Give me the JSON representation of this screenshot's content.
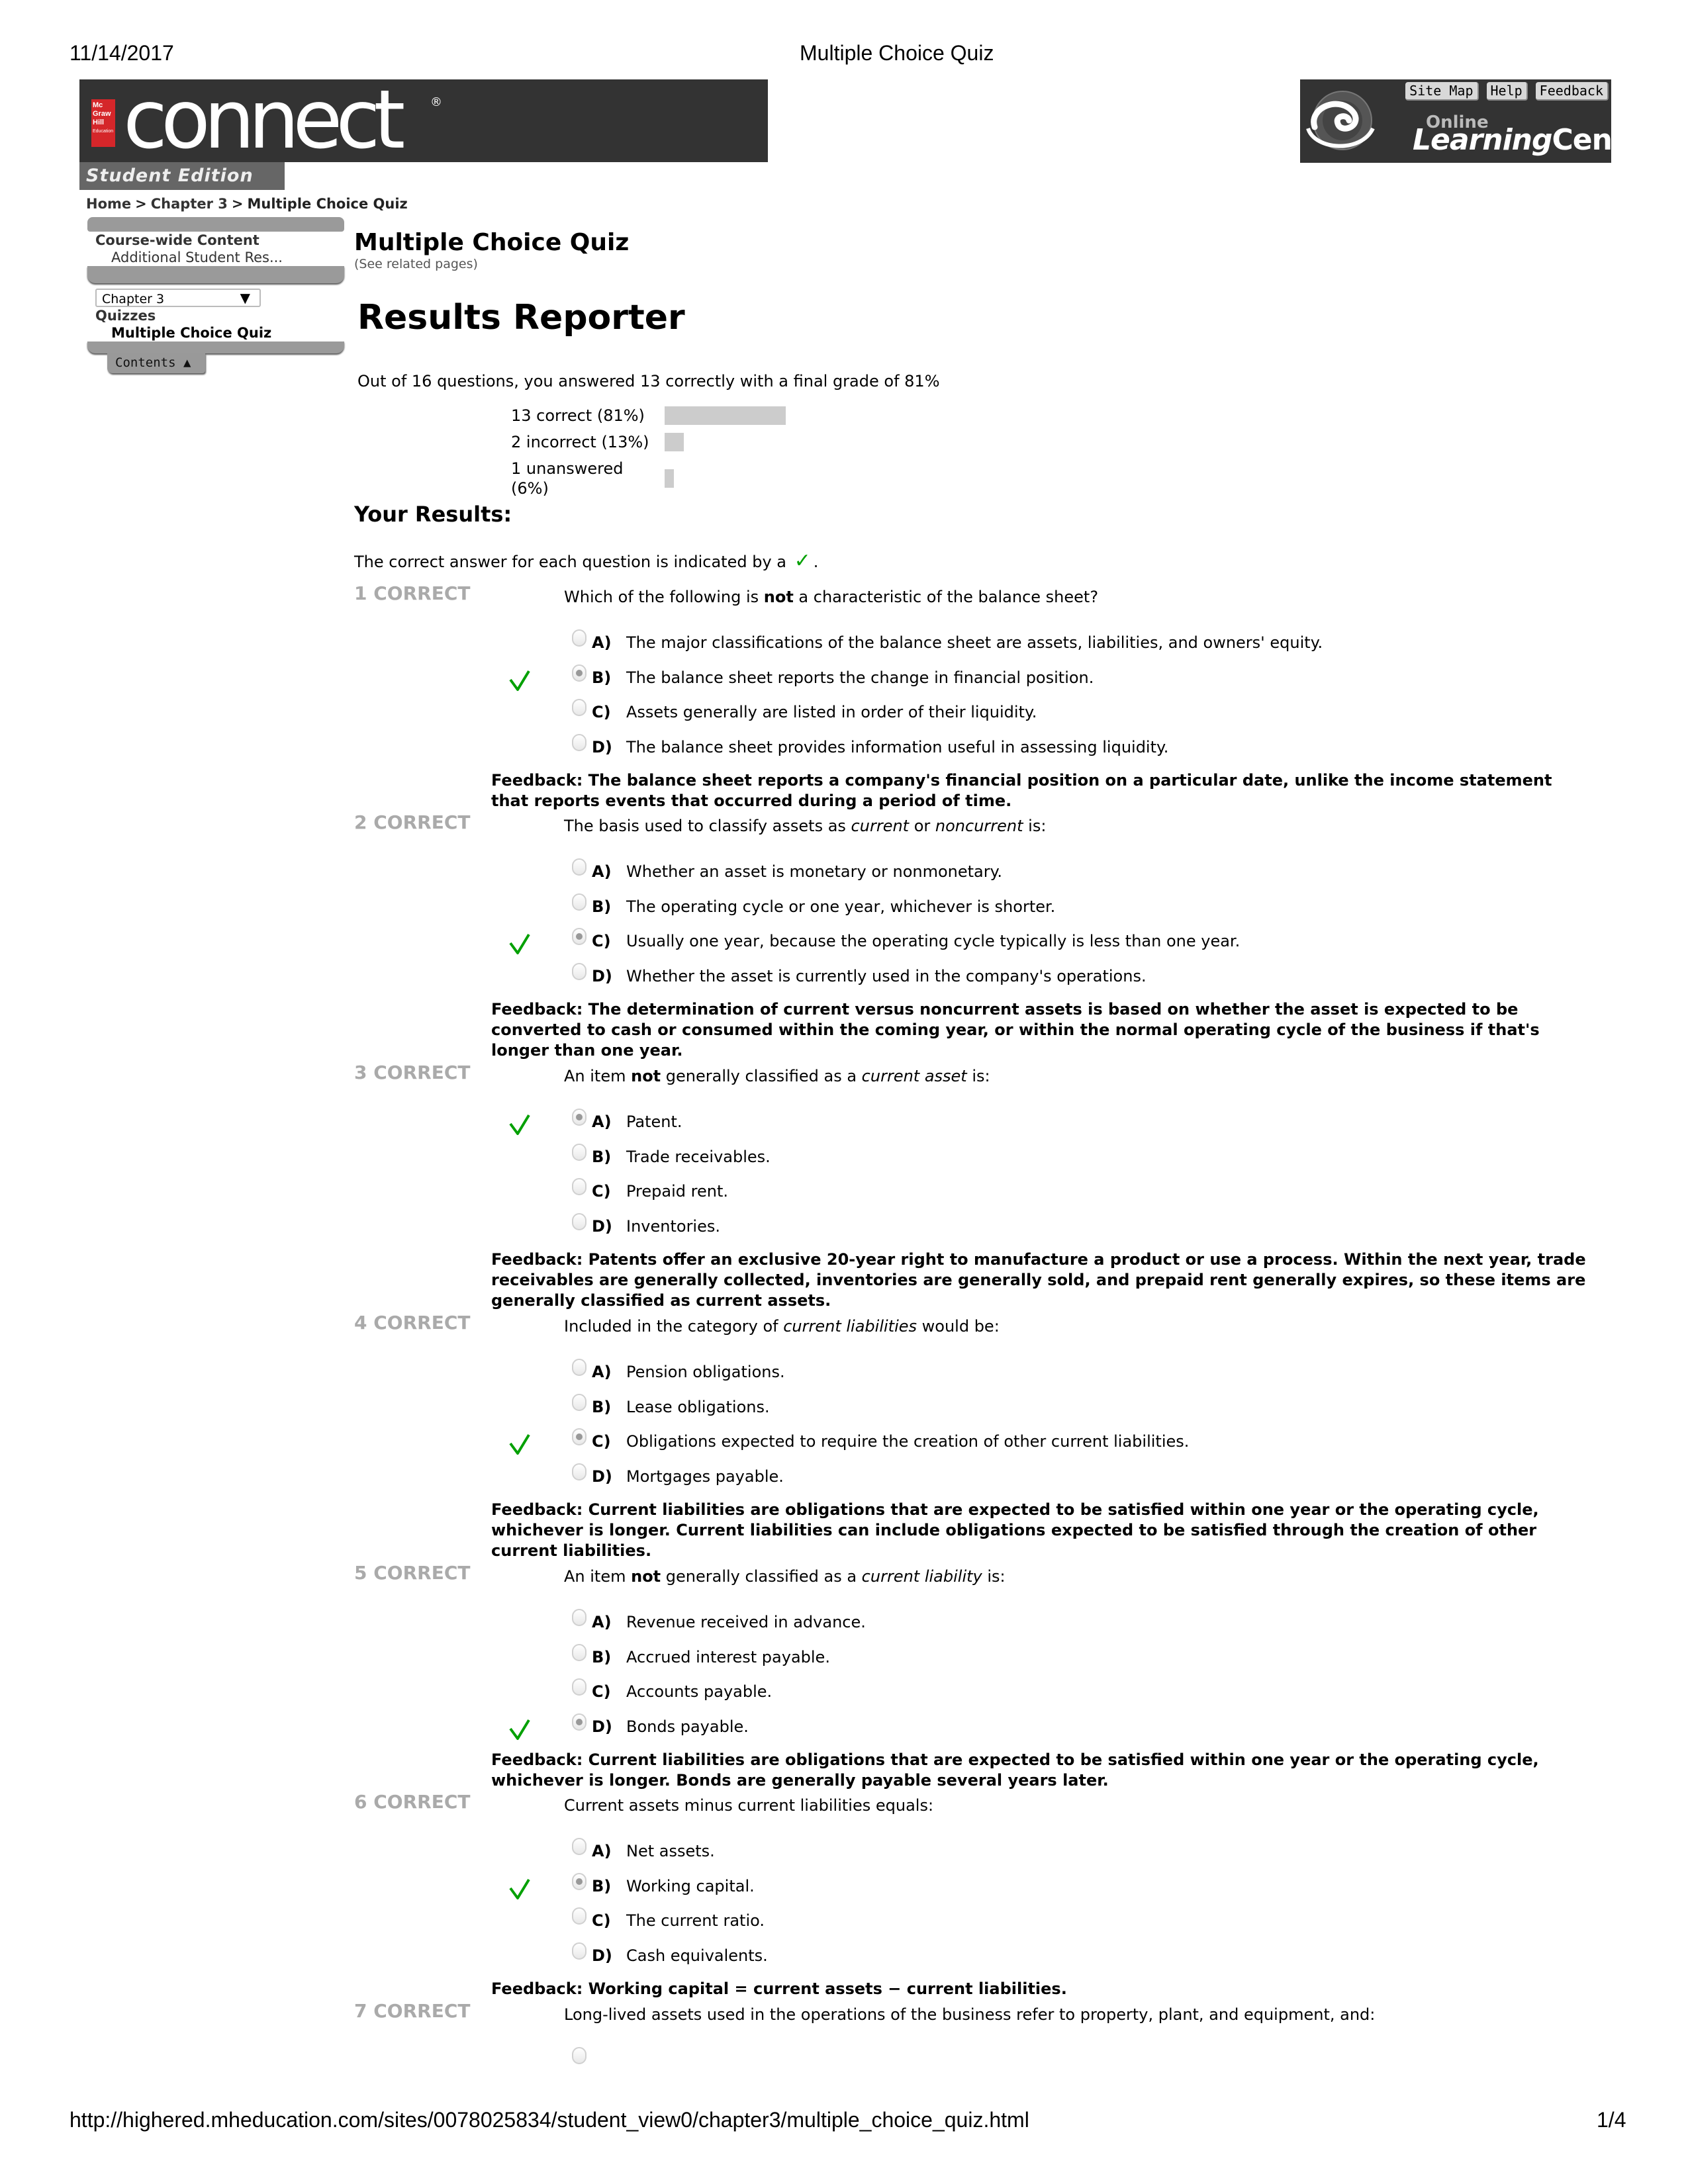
{
  "print_header": {
    "date": "11/14/2017",
    "title": "Multiple Choice Quiz"
  },
  "print_footer": {
    "url": "http://highered.mheducation.com/sites/0078025834/student_view0/chapter3/multiple_choice_quiz.html",
    "page": "1/4"
  },
  "brand": {
    "logo_lines": [
      "Mc",
      "Graw",
      "Hill",
      "Education"
    ],
    "wordmark": "connect",
    "registered": "®",
    "edition": "Student Edition"
  },
  "olc": {
    "buttons": [
      "Site Map",
      "Help",
      "Feedback"
    ],
    "online": "Online",
    "learning": "Learning",
    "center": "Center"
  },
  "breadcrumb": [
    {
      "label": "Home"
    },
    {
      "label": "Chapter 3"
    },
    {
      "label": "Multiple Choice Quiz"
    }
  ],
  "breadcrumb_sep": ">",
  "sidebar": {
    "section_title": "Course-wide Content",
    "section_item": "Additional Student Res...",
    "chapter_select": "Chapter 3",
    "quizzes_title": "Quizzes",
    "quizzes_item": "Multiple Choice Quiz",
    "contents_tab": "Contents ▲"
  },
  "main": {
    "title": "Multiple Choice Quiz",
    "see_related": "(See related pages)",
    "results_title": "Results Reporter",
    "summary": "Out of 16 questions, you answered 13 correctly with a final grade of 81%",
    "your_results": "Your Results:",
    "legend_prefix": "The correct answer for each question is indicated by a",
    "legend_suffix": "."
  },
  "results_bars": [
    {
      "label": "13 correct (81%)",
      "percent": 81
    },
    {
      "label": "2 incorrect (13%)",
      "percent": 13
    },
    {
      "label": "1 unanswered (6%)",
      "percent": 6
    }
  ],
  "questions": [
    {
      "status": "1 CORRECT",
      "text_html": "Which of the following is <b>not</b> a characteristic of the balance sheet?",
      "options": [
        {
          "letter": "A)",
          "text": "The major classifications of the balance sheet are assets, liabilities, and owners' equity."
        },
        {
          "letter": "B)",
          "text": "The balance sheet reports the change in financial position."
        },
        {
          "letter": "C)",
          "text": "Assets generally are listed in order of their liquidity."
        },
        {
          "letter": "D)",
          "text": "The balance sheet provides information useful in assessing liquidity."
        }
      ],
      "selected": 1,
      "correct": 1,
      "feedback": "Feedback: The balance sheet reports a company's financial position on a particular date, unlike the income statement that reports events that occurred during a period of time."
    },
    {
      "status": "2 CORRECT",
      "text_html": "The basis used to classify assets as <i>current</i> or <i>noncurrent</i> is:",
      "options": [
        {
          "letter": "A)",
          "text": "Whether an asset is monetary or nonmonetary."
        },
        {
          "letter": "B)",
          "text": "The operating cycle or one year, whichever is shorter."
        },
        {
          "letter": "C)",
          "text": "Usually one year, because the operating cycle typically is less than one year."
        },
        {
          "letter": "D)",
          "text": "Whether the asset is currently used in the company's operations."
        }
      ],
      "selected": 2,
      "correct": 2,
      "feedback": "Feedback: The determination of current versus noncurrent assets is based on whether the asset is expected to be converted to cash or consumed within the coming year, or within the normal operating cycle of the business if that's longer than one year."
    },
    {
      "status": "3 CORRECT",
      "text_html": "An item <b>not</b> generally classified as a <i>current asset</i> is:",
      "options": [
        {
          "letter": "A)",
          "text": "Patent."
        },
        {
          "letter": "B)",
          "text": "Trade receivables."
        },
        {
          "letter": "C)",
          "text": "Prepaid rent."
        },
        {
          "letter": "D)",
          "text": "Inventories."
        }
      ],
      "selected": 0,
      "correct": 0,
      "feedback": "Feedback: Patents offer an exclusive 20-year right to manufacture a product or use a process. Within the next year, trade receivables are generally collected, inventories are generally sold, and prepaid rent generally expires, so these items are generally classified as current assets."
    },
    {
      "status": "4 CORRECT",
      "text_html": "Included in the category of <i>current liabilities</i> would be:",
      "options": [
        {
          "letter": "A)",
          "text": "Pension obligations."
        },
        {
          "letter": "B)",
          "text": "Lease obligations."
        },
        {
          "letter": "C)",
          "text": "Obligations expected to require the creation of other current liabilities."
        },
        {
          "letter": "D)",
          "text": "Mortgages payable."
        }
      ],
      "selected": 2,
      "correct": 2,
      "feedback": "Feedback: Current liabilities are obligations that are expected to be satisfied within one year or the operating cycle, whichever is longer. Current liabilities can include obligations expected to be satisfied through the creation of other current liabilities."
    },
    {
      "status": "5 CORRECT",
      "text_html": "An item <b>not</b> generally classified as a <i>current liability</i> is:",
      "options": [
        {
          "letter": "A)",
          "text": "Revenue received in advance."
        },
        {
          "letter": "B)",
          "text": "Accrued interest payable."
        },
        {
          "letter": "C)",
          "text": "Accounts payable."
        },
        {
          "letter": "D)",
          "text": "Bonds payable."
        }
      ],
      "selected": 3,
      "correct": 3,
      "feedback": "Feedback: Current liabilities are obligations that are expected to be satisfied within one year or the operating cycle, whichever is longer. Bonds are generally payable several years later."
    },
    {
      "status": "6 CORRECT",
      "text_html": "Current assets minus current liabilities equals:",
      "options": [
        {
          "letter": "A)",
          "text": "Net assets."
        },
        {
          "letter": "B)",
          "text": "Working capital."
        },
        {
          "letter": "C)",
          "text": "The current ratio."
        },
        {
          "letter": "D)",
          "text": "Cash equivalents."
        }
      ],
      "selected": 1,
      "correct": 1,
      "feedback": "Feedback: Working capital = current assets − current liabilities."
    },
    {
      "status": "7 CORRECT",
      "text_html": "Long-lived assets used in the operations of the business refer to property, plant, and equipment, and:",
      "options": [
        {
          "letter": "",
          "text": ""
        }
      ],
      "selected": -1,
      "correct": -1,
      "feedback": ""
    }
  ],
  "colors": {
    "check": "#00a000",
    "status": "#aaaaaa",
    "bar": "#cccccc",
    "header_bg": "#333333",
    "brand_red": "#d5262a"
  }
}
